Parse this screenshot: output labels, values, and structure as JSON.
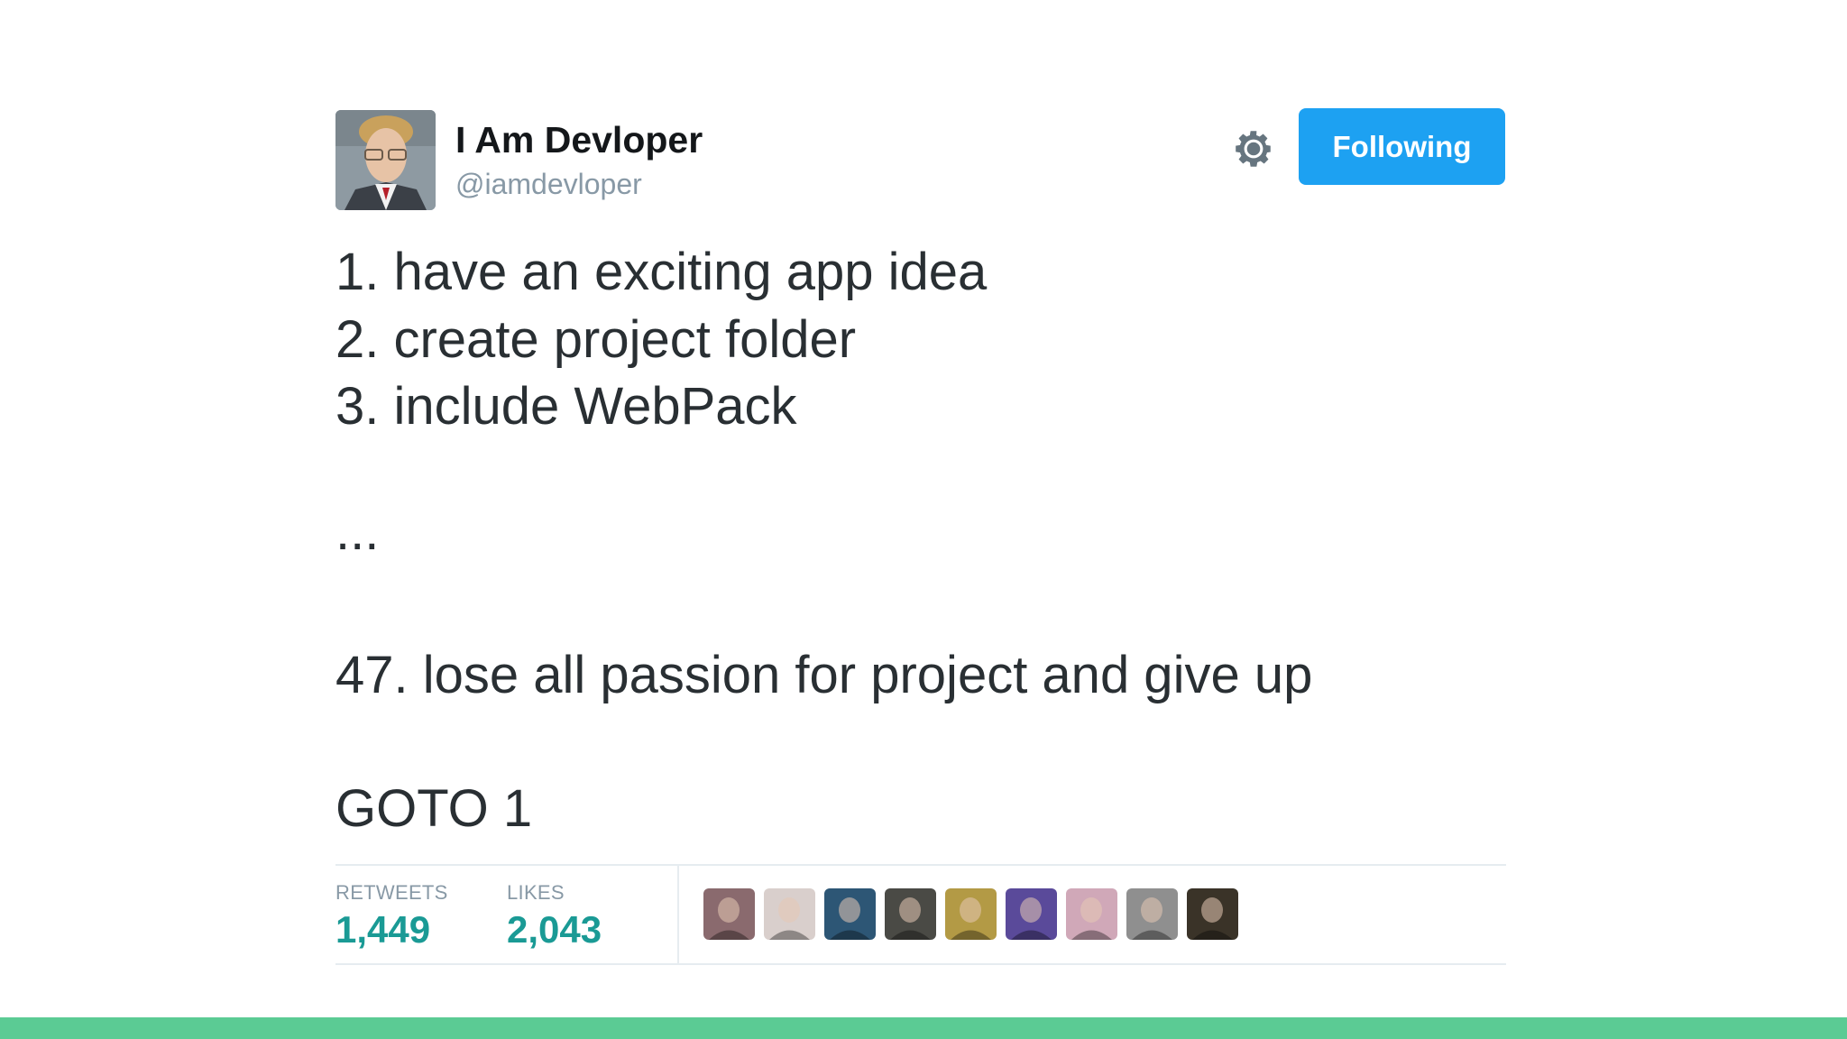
{
  "author": {
    "display_name": "I Am Devloper",
    "handle": "@iamdevloper",
    "avatar_icon": "profile-photo"
  },
  "actions": {
    "settings_icon": "gear-icon",
    "follow_label": "Following"
  },
  "tweet": {
    "lines": [
      "1. have an exciting app idea",
      "2. create project folder",
      "3. include WebPack",
      "...",
      "47. lose all passion for project and give up",
      "GOTO 1"
    ]
  },
  "stats": {
    "retweets_label": "RETWEETS",
    "retweets_count": "1,449",
    "likes_label": "LIKES",
    "likes_count": "2,043"
  },
  "likers": [
    {
      "name": "liker-avatar-1",
      "color": "#8a6a6e"
    },
    {
      "name": "liker-avatar-2",
      "color": "#d9cfcc"
    },
    {
      "name": "liker-avatar-3",
      "color": "#2d5675"
    },
    {
      "name": "liker-avatar-4",
      "color": "#4a4a45"
    },
    {
      "name": "liker-avatar-5",
      "color": "#b39a45"
    },
    {
      "name": "liker-avatar-6",
      "color": "#5a4a9a"
    },
    {
      "name": "liker-avatar-7",
      "color": "#d0a8b8"
    },
    {
      "name": "liker-avatar-8",
      "color": "#8f8f8f"
    },
    {
      "name": "liker-avatar-9",
      "color": "#3a3328"
    }
  ],
  "colors": {
    "follow_button": "#1da1f2",
    "stat_value": "#1a9a95",
    "bottom_bar": "#5bcb94"
  }
}
